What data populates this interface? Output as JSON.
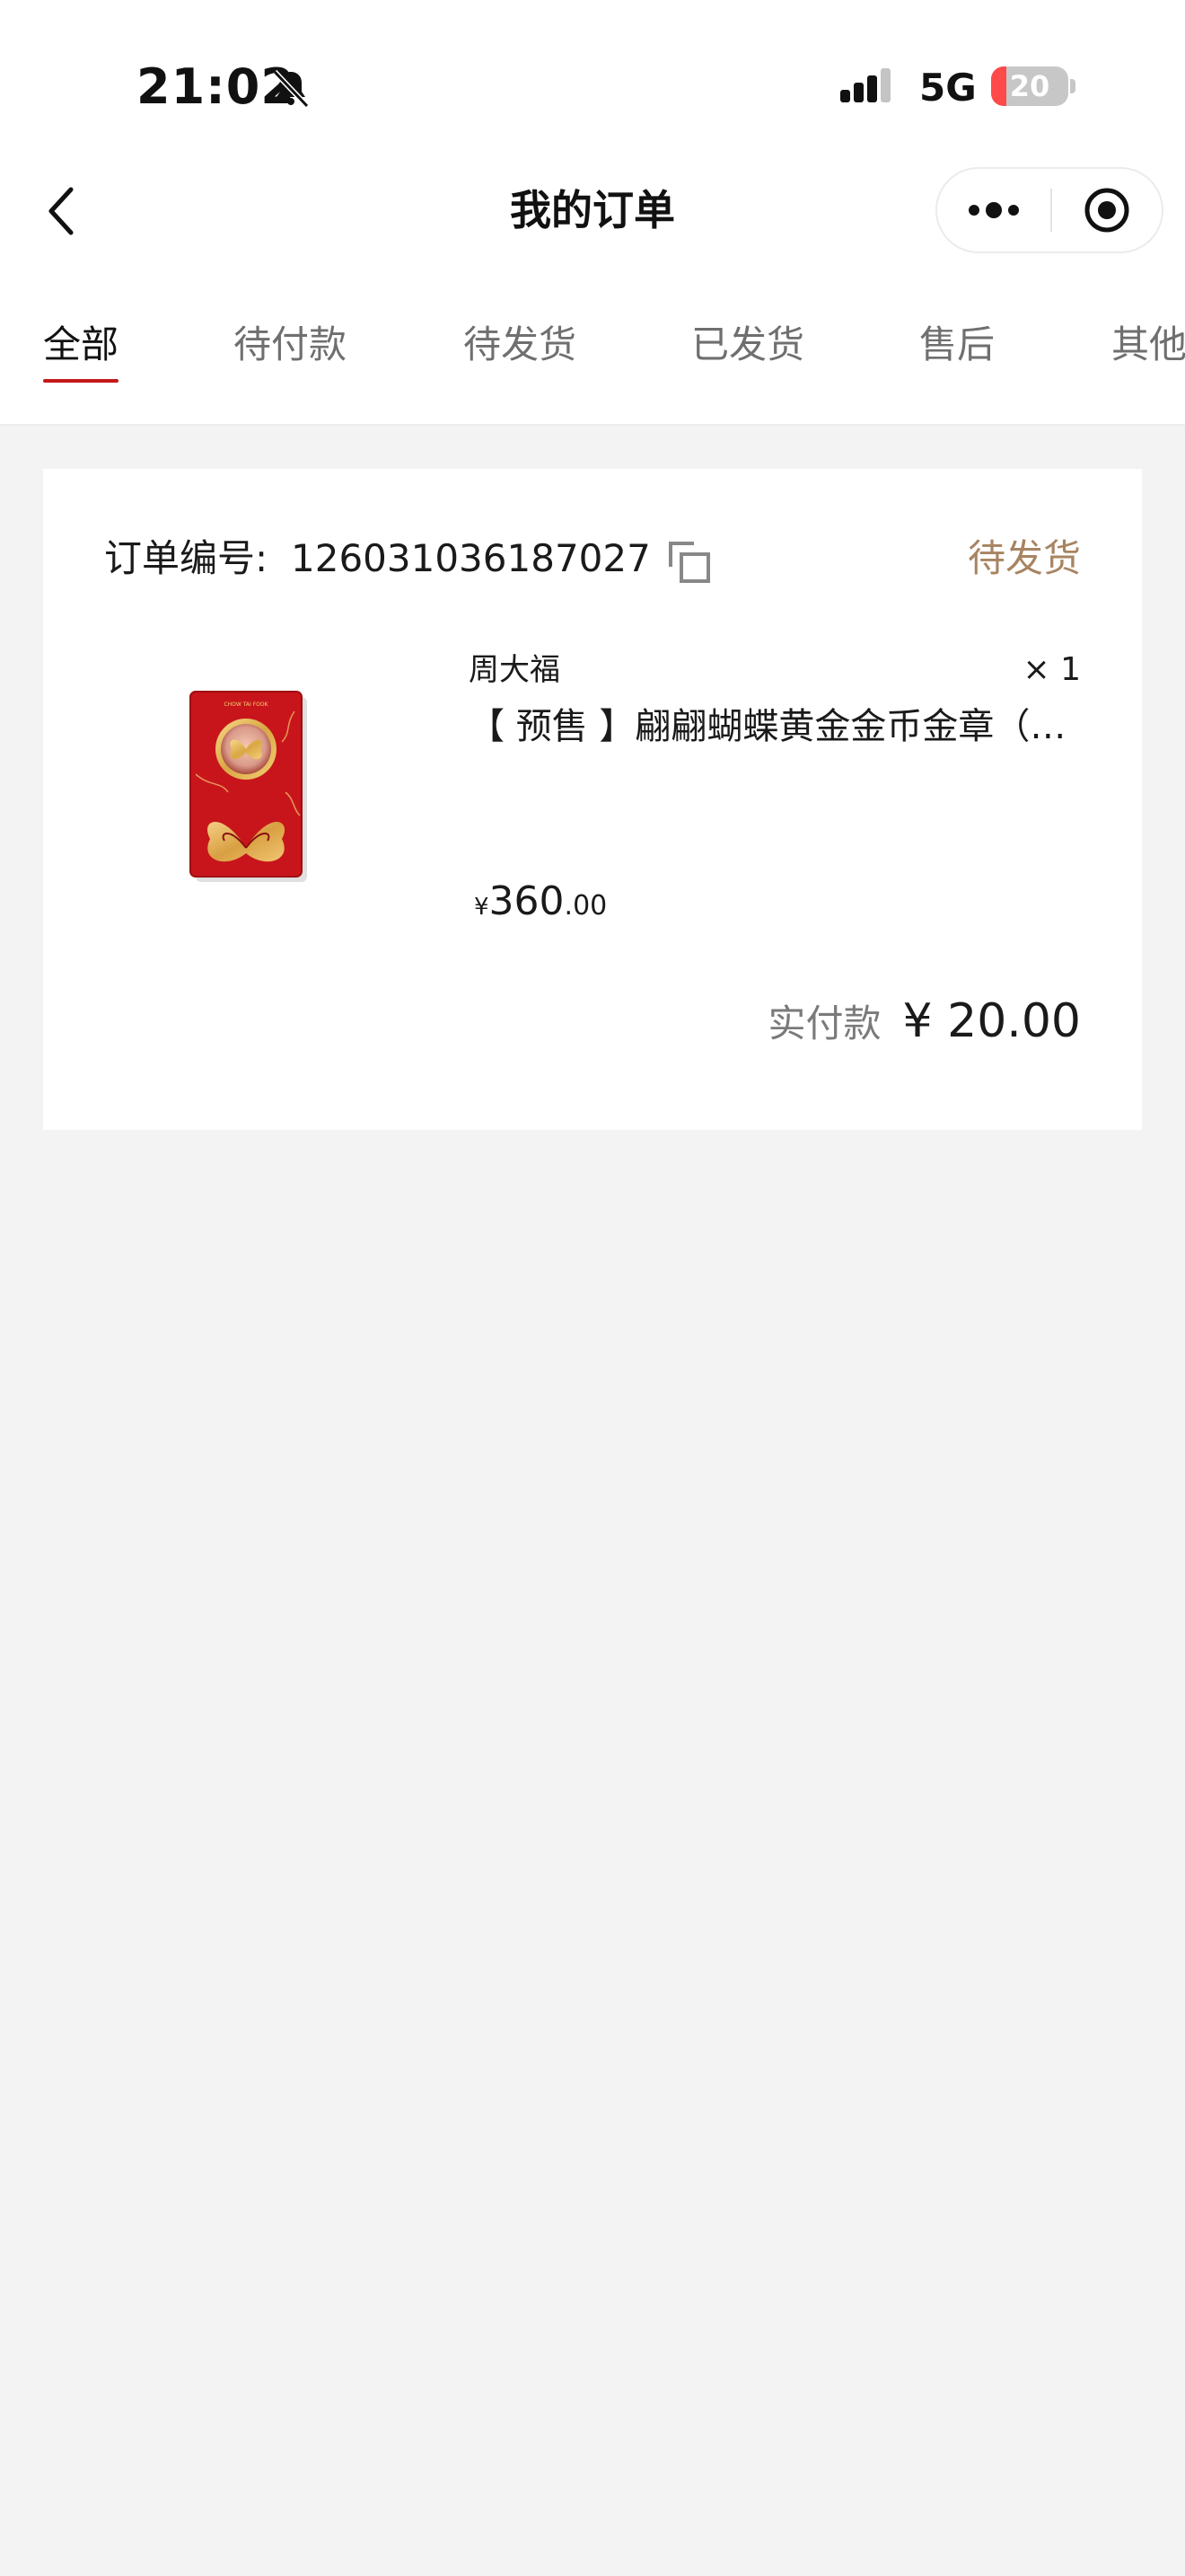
{
  "status_bar": {
    "time": "21:02",
    "network": "5G",
    "battery_level": "20",
    "battery_fraction": 0.2,
    "icons": [
      "bell-off-icon",
      "signal-icon"
    ]
  },
  "nav": {
    "title": "我的订单",
    "back_icon": "back-arrow-icon",
    "more_icon": "more-dots-icon",
    "close_icon": "target-close-icon"
  },
  "tabs": [
    {
      "label": "全部",
      "active": true
    },
    {
      "label": "待付款",
      "active": false
    },
    {
      "label": "待发货",
      "active": false
    },
    {
      "label": "已发货",
      "active": false
    },
    {
      "label": "售后",
      "active": false
    },
    {
      "label": "其他",
      "active": false
    }
  ],
  "order": {
    "number_label": "订单编号:",
    "number": "126031036187027",
    "copy_icon": "copy-icon",
    "status": "待发货",
    "brand": "周大福",
    "quantity": "× 1",
    "product_name": "【 预售 】翩翩蝴蝶黄金金币金章（…",
    "price": {
      "currency": "¥",
      "integer": "360",
      "decimal": ".00"
    },
    "paid_label": "实付款",
    "paid_amount": "¥ 20.00"
  },
  "colors": {
    "accent_red": "#c41a1a",
    "status_brown": "#a88462",
    "battery_red": "#ff4a4a",
    "page_bg": "#f3f3f3"
  }
}
